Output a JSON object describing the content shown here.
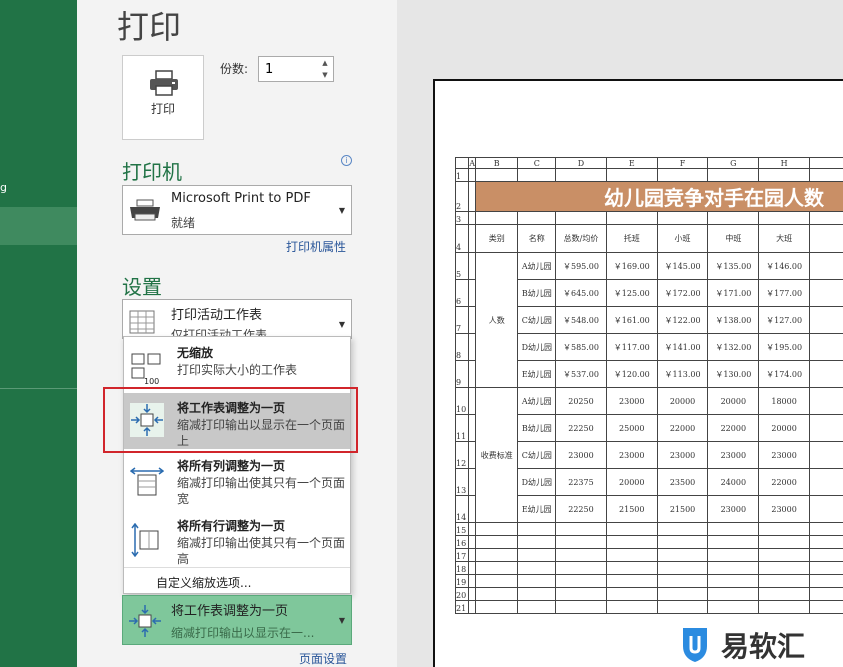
{
  "sidebar": {
    "partial_label": "g"
  },
  "backstage": {
    "title": "打印"
  },
  "print_button": {
    "label": "打印",
    "icon": "printer-icon"
  },
  "copies": {
    "label": "份数:",
    "value": "1"
  },
  "printer": {
    "heading": "打印机",
    "name": "Microsoft Print to PDF",
    "status": "就绪",
    "properties_link": "打印机属性"
  },
  "settings": {
    "heading": "设置",
    "active_sheet": {
      "title": "打印活动工作表",
      "desc": "仅打印活动工作表"
    },
    "scaling_menu": [
      {
        "title": "无缩放",
        "desc": "打印实际大小的工作表",
        "icon": "no-scaling-icon"
      },
      {
        "title": "将工作表调整为一页",
        "desc": "缩减打印输出以显示在一个页面上",
        "icon": "fit-sheet-icon",
        "selected": true
      },
      {
        "title": "将所有列调整为一页",
        "desc": "缩减打印输出使其只有一个页面宽",
        "icon": "fit-columns-icon"
      },
      {
        "title": "将所有行调整为一页",
        "desc": "缩减打印输出使其只有一个页面高",
        "icon": "fit-rows-icon"
      }
    ],
    "custom_scaling": "自定义缩放选项...",
    "current_scaling": {
      "title": "将工作表调整为一页",
      "desc": "缩减打印输出以显示在一..."
    },
    "page_setup_link": "页面设置"
  },
  "preview": {
    "col_headers": [
      "A",
      "B",
      "C",
      "D",
      "E",
      "F",
      "G",
      "H"
    ],
    "row_numbers": [
      "1",
      "2",
      "3",
      "4",
      "5",
      "6",
      "7",
      "8",
      "9",
      "10",
      "11",
      "12",
      "13",
      "14",
      "15",
      "16",
      "17",
      "18",
      "19",
      "20",
      "21"
    ],
    "banner": "幼儿园竞争对手在园人数",
    "headers": [
      "类别",
      "名称",
      "总数/均价",
      "托班",
      "小班",
      "中班",
      "大班"
    ],
    "group1": "人数",
    "group2": "收费标准",
    "rows": [
      [
        "A幼儿园",
        "￥595.00",
        "￥169.00",
        "￥145.00",
        "￥135.00",
        "￥146.00"
      ],
      [
        "B幼儿园",
        "￥645.00",
        "￥125.00",
        "￥172.00",
        "￥171.00",
        "￥177.00"
      ],
      [
        "C幼儿园",
        "￥548.00",
        "￥161.00",
        "￥122.00",
        "￥138.00",
        "￥127.00"
      ],
      [
        "D幼儿园",
        "￥585.00",
        "￥117.00",
        "￥141.00",
        "￥132.00",
        "￥195.00"
      ],
      [
        "E幼儿园",
        "￥537.00",
        "￥120.00",
        "￥113.00",
        "￥130.00",
        "￥174.00"
      ],
      [
        "A幼儿园",
        "20250",
        "23000",
        "20000",
        "20000",
        "18000"
      ],
      [
        "B幼儿园",
        "22250",
        "25000",
        "22000",
        "22000",
        "20000"
      ],
      [
        "C幼儿园",
        "23000",
        "23000",
        "23000",
        "23000",
        "23000"
      ],
      [
        "D幼儿园",
        "22375",
        "20000",
        "23500",
        "24000",
        "22000"
      ],
      [
        "E幼儿园",
        "22250",
        "21500",
        "21500",
        "23000",
        "23000"
      ]
    ]
  },
  "watermark": {
    "text": "易软汇"
  },
  "colors": {
    "excel_green": "#217346",
    "selected_scaling": "#7fc79b",
    "highlight_red": "#d1252b",
    "banner": "#c98f66"
  }
}
